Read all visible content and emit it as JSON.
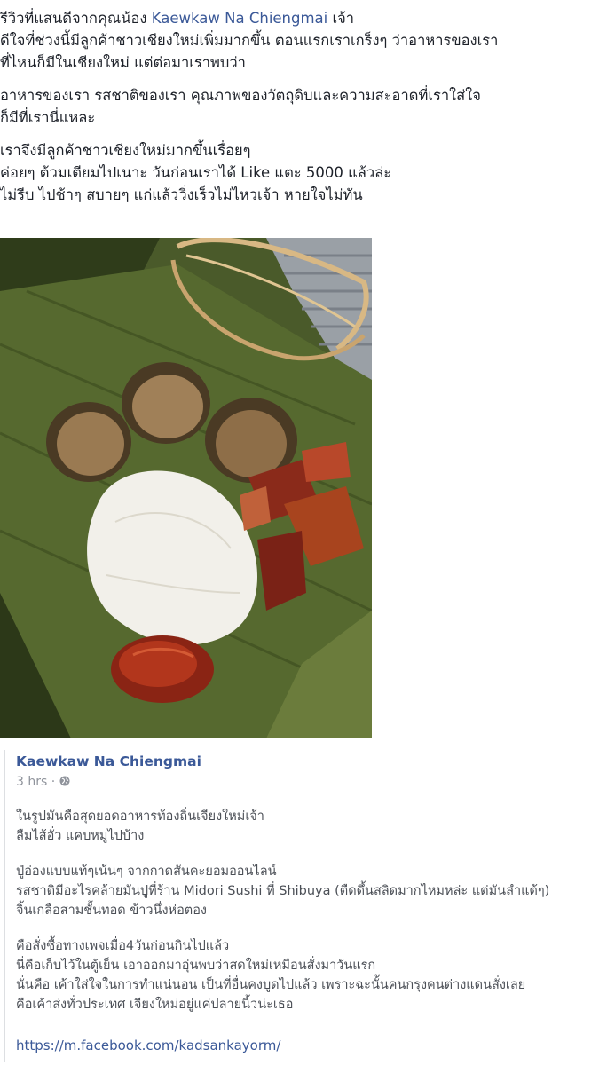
{
  "post": {
    "line1_prefix": "รีวิวที่แสนดีจากคุณน้อง",
    "line1_link": "Kaewkaw Na Chiengmai",
    "line1_suffix": "เจ้า",
    "line2": "ดีใจที่ช่วงนี้มีลูกค้าชาวเชียงใหม่เพิ่มมากขึ้น ตอนแรกเราเกร็งๆ ว่าอาหารของเรา",
    "line3": "ที่ไหนก็มีในเชียงใหม่ แต่ต่อมาเราพบว่า",
    "line4": "อาหารของเรา รสชาติของเรา คุณภาพของวัตถุดิบและความสะอาดที่เราใส่ใจ",
    "line5": "ก็มีที่เรานี่แหละ",
    "line6": "เราจึงมีลูกค้าชาวเชียงใหม่มากขึ้นเรื่อยๆ",
    "line7": "ค่อยๆ ต้วมเตียมไปเนาะ วันก่อนเราได้ Like แตะ 5000 แล้วล่ะ",
    "line8": "ไม่รีบ ไปช้าๆ สบายๆ แก่แล้ววิ่งเร็วไม่ไหวเจ้า หายใจไม่ทัน"
  },
  "shared_post": {
    "author": "Kaewkaw Na Chiengmai",
    "time": "3 hrs",
    "separator": "·",
    "privacy_icon": "globe-icon",
    "p1_l1": "ในรูปมันคือสุดยอดอาหารท้องถิ่นเจียงใหม่เจ้า",
    "p1_l2": "ลืมไส้อั่ว แคบหมูไปบ้าง",
    "p2_l1": "ปู่อ่องแบบแท้ๆเน้นๆ จากกาดสันคะยอมออนไลน์",
    "p2_l2": "รสชาติมีอะไรคล้ายมันปูที่ร้าน Midori Sushi ที่ Shibuya (ตืดดึ้นสลิดมากไหมหล่ะ แต่มันลำแต้ๆ)",
    "p2_l3": "จิ้นเกลือสามชั้นทอด ข้าวนึ่งห่อตอง",
    "p3_l1": "คือสั่งซื้อทางเพจเมื่อ4วันก่อนกินไปแล้ว",
    "p3_l2": "นี่คือเก็บไว้ในตู้เย็น เอาออกมาอุ่นพบว่าสดใหม่เหมือนสั่งมาวันแรก",
    "p3_l3": "นั่นคือ เค้าใส่ใจในการทำแน่นอน เป็นที่อื่นคงบูดไปแล้ว เพราะฉะนั้นคนกรุงคนต่างแดนสั่งเลย",
    "p3_l4": "คือเค้าส่งทั่วประเทศ เจียงใหม่อยู่แค่ปลายนิ้วน่ะเธอ",
    "url": "https://m.facebook.com/kadsankayorm/"
  },
  "colors": {
    "link": "#3b5998",
    "text": "#1d2129",
    "muted": "#90949c",
    "quote_bar": "#dddfe2"
  }
}
